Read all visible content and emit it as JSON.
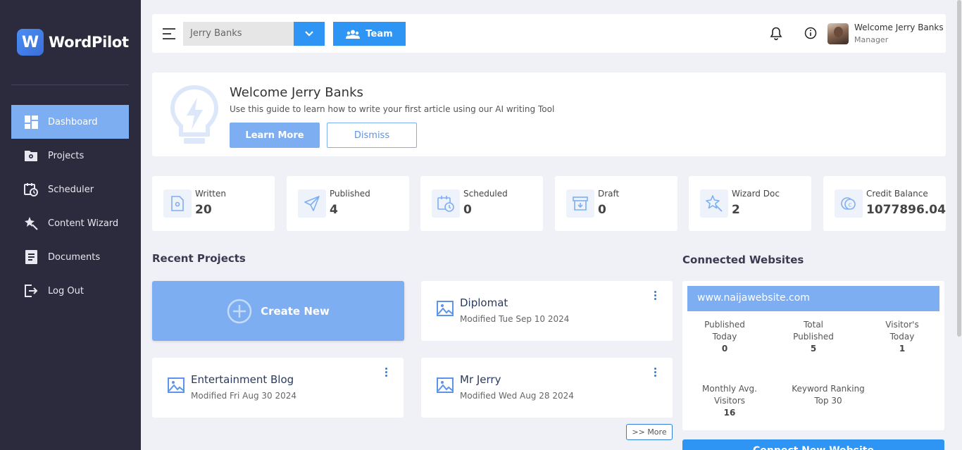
{
  "app": {
    "name": "WordPilot",
    "logo_letter": "W"
  },
  "sidebar": {
    "items": [
      {
        "label": "Dashboard",
        "icon": "dashboard-icon",
        "active": true
      },
      {
        "label": "Projects",
        "icon": "folder-gear-icon"
      },
      {
        "label": "Scheduler",
        "icon": "calendar-clock-icon"
      },
      {
        "label": "Content Wizard",
        "icon": "wizard-star-icon"
      },
      {
        "label": "Documents",
        "icon": "document-icon"
      },
      {
        "label": "Log Out",
        "icon": "logout-icon"
      }
    ]
  },
  "topbar": {
    "team_select_value": "Jerry Banks",
    "team_button_label": "Team",
    "user": {
      "name": "Welcome Jerry Banks",
      "role": "Manager"
    }
  },
  "welcome": {
    "title": "Welcome Jerry Banks",
    "subtitle": "Use this guide to learn how to write your first article using our AI writing Tool",
    "learn_more_label": "Learn More",
    "dismiss_label": "Dismiss"
  },
  "stats": [
    {
      "label": "Written",
      "value": "20",
      "icon": "file-gear-icon"
    },
    {
      "label": "Published",
      "value": "4",
      "icon": "send-icon"
    },
    {
      "label": "Scheduled",
      "value": "0",
      "icon": "calendar-clock-icon"
    },
    {
      "label": "Draft",
      "value": "0",
      "icon": "archive-icon"
    },
    {
      "label": "Wizard Doc",
      "value": "2",
      "icon": "wizard-star-icon"
    },
    {
      "label": "Credit Balance",
      "value": "1077896.04",
      "icon": "coins-icon"
    }
  ],
  "recent_projects": {
    "title": "Recent Projects",
    "create_label": "Create New",
    "items": [
      {
        "title": "Diplomat",
        "modified": "Modified Tue Sep 10 2024"
      },
      {
        "title": "Entertainment Blog",
        "modified": "Modified Fri Aug 30 2024"
      },
      {
        "title": "Mr Jerry",
        "modified": "Modified Wed Aug 28 2024"
      }
    ],
    "more_label": ">> More"
  },
  "connected_websites": {
    "title": "Connected Websites",
    "site": "www.naijawebsite.com",
    "stats": {
      "published_today_label1": "Published",
      "published_today_label2": "Today",
      "published_today": "0",
      "total_published_label1": "Total",
      "total_published_label2": "Published",
      "total_published": "5",
      "visitors_today_label1": "Visitor's",
      "visitors_today_label2": "Today",
      "visitors_today": "1",
      "monthly_visitors_label1": "Monthly Avg.",
      "monthly_visitors_label2": "Visitors",
      "monthly_visitors": "16",
      "keyword_label1": "Keyword Ranking",
      "keyword_label2": "Top 30"
    },
    "connect_label": "Connect New Website"
  },
  "colors": {
    "sidebar": "#2b2b3d",
    "accent": "#2f95f5",
    "light_accent": "#7eaef2",
    "background": "#f0f0f7"
  }
}
